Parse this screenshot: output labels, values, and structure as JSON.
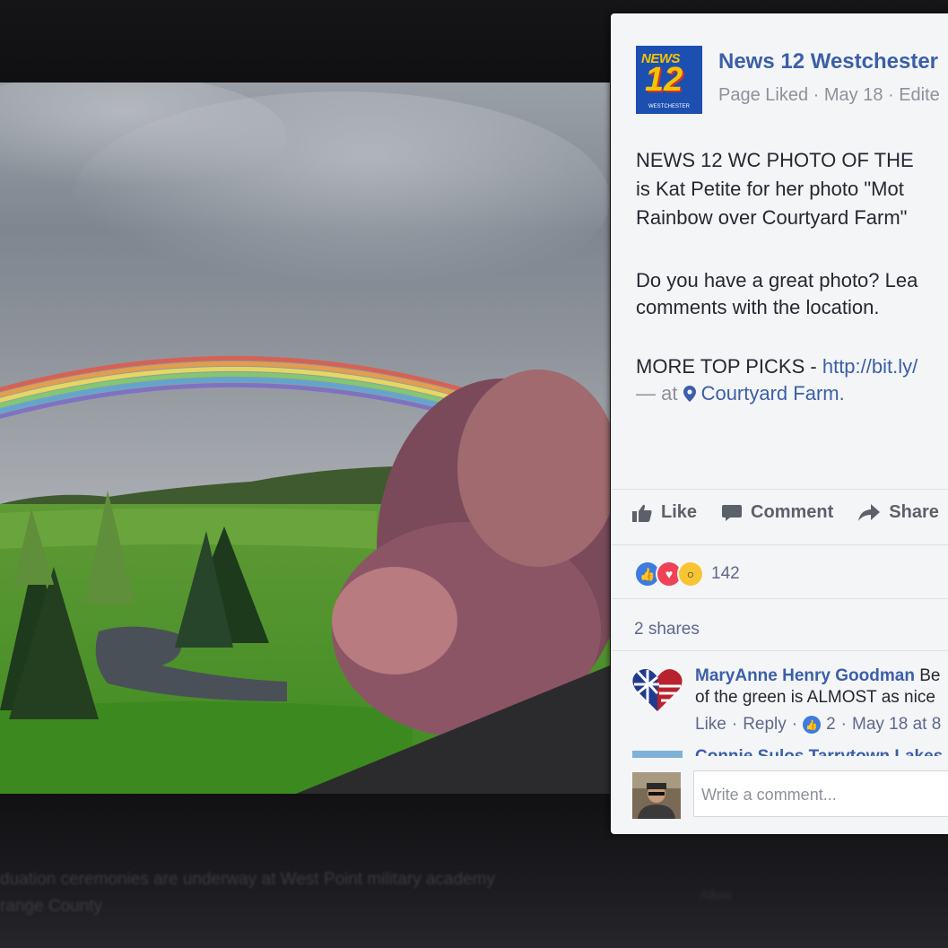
{
  "post": {
    "page_name": "News 12 Westchester",
    "meta": "Page Liked · May 18 · Edite",
    "logo": {
      "top": "NEWS",
      "number": "12",
      "bottom": "WESTCHESTER"
    },
    "text_lines": [
      "NEWS 12 WC PHOTO OF THE",
      "is Kat Petite for her photo \"Mot",
      "Rainbow over Courtyard Farm\"",
      "Do you have a great photo? Lea",
      "comments with the location."
    ],
    "top_picks": {
      "prefix": "MORE TOP PICKS - ",
      "link": "http://bit.ly/"
    },
    "location": {
      "prefix": "— at ",
      "place": "Courtyard Farm."
    },
    "actions": {
      "like": "Like",
      "comment": "Comment",
      "share": "Share"
    },
    "reactions": {
      "count": "142"
    },
    "shares": "2 shares",
    "comment": {
      "name": "MaryAnne Henry Goodman",
      "name_suffix": " Be",
      "text": "of the green is ALMOST as nice",
      "like": "Like",
      "reply": "Reply",
      "likes": "2",
      "date": "May 18 at 8"
    },
    "next_comment_name": "Connie Sulos Tarrytown Lakes",
    "composer": {
      "placeholder": "Write a comment..."
    }
  },
  "background": {
    "caption_line1": "duation ceremonies are underway at West Point military academy",
    "caption_line2": "range County",
    "side_label": "Allow"
  },
  "colors": {
    "fb_blue": "#3b5fa8",
    "card_bg": "#f4f5f7",
    "logo_blue": "#1c4fb0",
    "logo_yellow": "#f5c400"
  }
}
